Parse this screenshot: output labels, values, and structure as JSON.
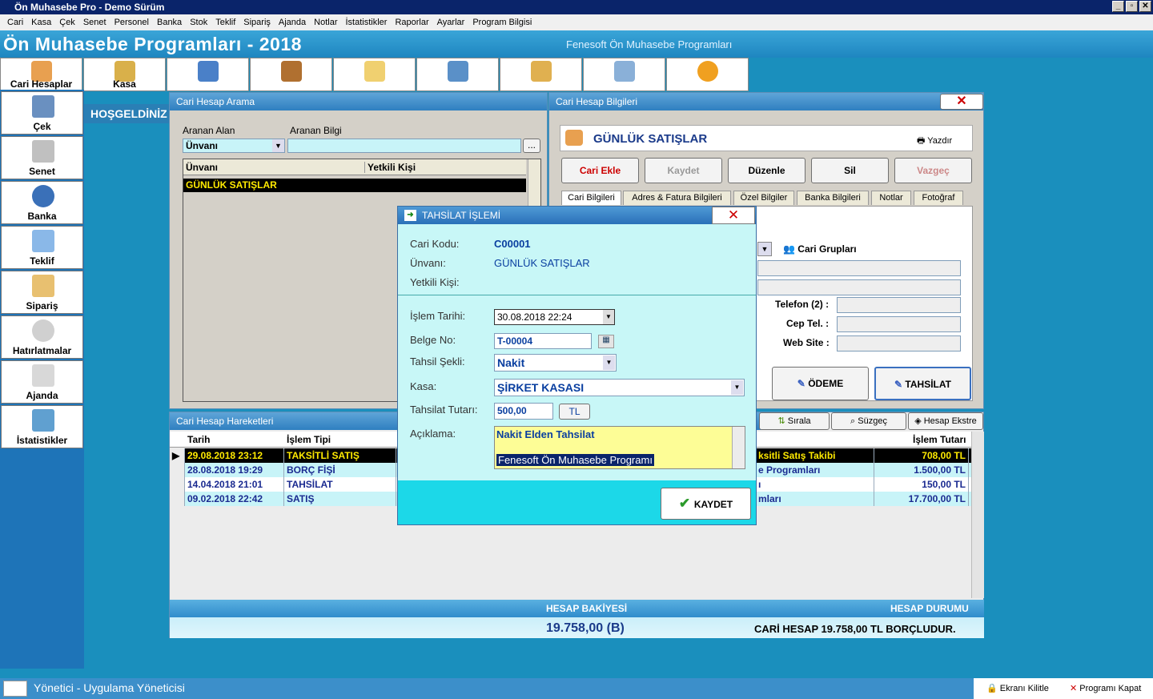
{
  "window": {
    "title": "Ön Muhasebe Pro - Demo Sürüm"
  },
  "menu": [
    "Cari",
    "Kasa",
    "Çek",
    "Senet",
    "Personel",
    "Banka",
    "Stok",
    "Teklif",
    "Sipariş",
    "Ajanda",
    "Notlar",
    "İstatistikler",
    "Raporlar",
    "Ayarlar",
    "Program Bilgisi"
  ],
  "banner": {
    "title": "Ön Muhasebe Programları - 2018",
    "subtitle": "Fenesoft Ön Muhasebe Programları"
  },
  "toolbar": [
    "Cari Hesaplar",
    "Kasa",
    "",
    "",
    "",
    "",
    "",
    "",
    ""
  ],
  "sidebar": [
    "Çek",
    "Senet",
    "Banka",
    "Teklif",
    "Sipariş",
    "Hatırlatmalar",
    "Ajanda",
    "İstatistikler"
  ],
  "welcome": "HOŞGELDİNİZ",
  "search_panel": {
    "title": "Cari Hesap Arama",
    "field_label": "Aranan Alan",
    "info_label": "Aranan Bilgi",
    "field_value": "Ünvanı",
    "browse": "...",
    "col1": "Ünvanı",
    "col2": "Yetkili Kişi",
    "row1": "GÜNLÜK SATIŞLAR"
  },
  "info_panel": {
    "title": "Cari Hesap Bilgileri",
    "name": "GÜNLÜK SATIŞLAR",
    "print": "Yazdır",
    "buttons": [
      "Cari Ekle",
      "Kaydet",
      "Düzenle",
      "Sil",
      "Vazgeç"
    ],
    "tabs": [
      "Cari Bilgileri",
      "Adres & Fatura Bilgileri",
      "Özel Bilgiler",
      "Banka Bilgileri",
      "Notlar",
      "Fotoğraf"
    ],
    "groups": "Cari Grupları",
    "tel2": "Telefon (2) :",
    "cep": "Cep Tel. :",
    "web": "Web Site :",
    "odeme": "ÖDEME",
    "tahsilat": "TAHSİLAT"
  },
  "movements": {
    "title": "Cari Hesap Hareketleri",
    "sort": "Sırala",
    "filter": "Süzgeç",
    "extract": "Hesap Ekstre",
    "headers": [
      "Tarih",
      "İşlem Tipi",
      "İşlem Tutarı"
    ],
    "rows": [
      {
        "date": "29.08.2018 23:12",
        "type": "TAKSİTLİ SATIŞ",
        "desc": "ksitli Satış Takibi",
        "amount": "708,00 TL"
      },
      {
        "date": "28.08.2018 19:29",
        "type": "BORÇ FİŞİ",
        "desc": "e Programları",
        "amount": "1.500,00 TL"
      },
      {
        "date": "14.04.2018 21:01",
        "type": "TAHSİLAT",
        "desc": "ı",
        "amount": "150,00 TL"
      },
      {
        "date": "09.02.2018 22:42",
        "type": "SATIŞ",
        "desc": "mları",
        "amount": "17.700,00 TL"
      }
    ]
  },
  "balance": {
    "label": "HESAP BAKİYESİ",
    "value": "19.758,00 (B)",
    "status_label": "HESAP DURUMU",
    "status": "CARİ HESAP 19.758,00 TL BORÇLUDUR."
  },
  "dialog": {
    "title": "TAHSİLAT İŞLEMİ",
    "code_label": "Cari Kodu:",
    "code": "C00001",
    "name_label": "Ünvanı:",
    "name": "GÜNLÜK SATIŞLAR",
    "contact_label": "Yetkili Kişi:",
    "date_label": "İşlem Tarihi:",
    "date": "30.08.2018 22:24",
    "doc_label": "Belge No:",
    "doc": "T-00004",
    "method_label": "Tahsil Şekli:",
    "method": "Nakit",
    "cash_label": "Kasa:",
    "cash": "ŞİRKET KASASI",
    "amount_label": "Tahsilat Tutarı:",
    "amount": "500,00",
    "currency": "TL",
    "note_label": "Açıklama:",
    "note1": "Nakit Elden Tahsilat",
    "note2": "Fenesoft Ön Muhasebe Programı",
    "save": "KAYDET"
  },
  "status": {
    "user": "Yönetici - Uygulama Yöneticisi",
    "lock": "Ekranı Kilitle",
    "close": "Programı Kapat"
  }
}
